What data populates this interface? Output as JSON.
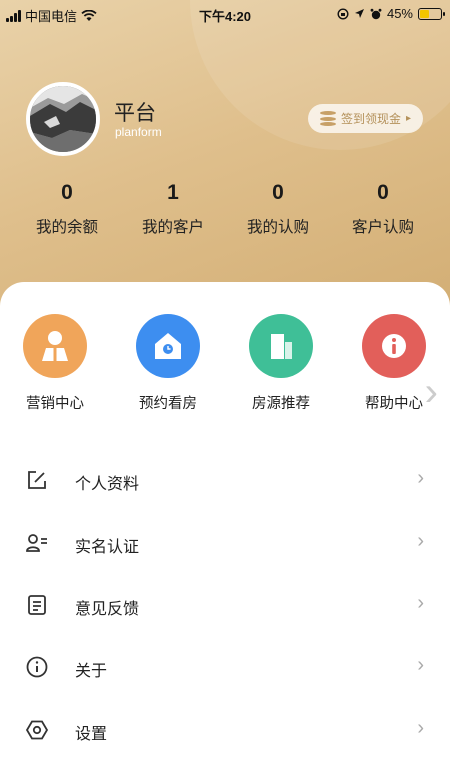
{
  "status_bar": {
    "carrier": "中国电信",
    "time": "下午4:20",
    "battery_percent": "45%",
    "battery_level": 0.45,
    "battery_fill_color": "#f2c500"
  },
  "profile": {
    "name": "平台",
    "subtitle": "planform",
    "checkin_label": "签到领现金"
  },
  "stats": [
    {
      "value": "0",
      "label": "我的余额"
    },
    {
      "value": "1",
      "label": "我的客户"
    },
    {
      "value": "0",
      "label": "我的认购"
    },
    {
      "value": "0",
      "label": "客户认购"
    }
  ],
  "quick_actions": [
    {
      "label": "营销中心",
      "icon": "person-icon",
      "color": "#f0a55a"
    },
    {
      "label": "预约看房",
      "icon": "house-icon",
      "color": "#3d8ef0"
    },
    {
      "label": "房源推荐",
      "icon": "building-icon",
      "color": "#3fbf97"
    },
    {
      "label": "帮助中心",
      "icon": "info-icon",
      "color": "#e25f5a"
    }
  ],
  "menu": [
    {
      "label": "个人资料",
      "icon": "edit-icon"
    },
    {
      "label": "实名认证",
      "icon": "user-id-icon"
    },
    {
      "label": "意见反馈",
      "icon": "document-icon"
    },
    {
      "label": "关于",
      "icon": "info-circle-icon"
    },
    {
      "label": "设置",
      "icon": "settings-icon"
    }
  ],
  "colors": {
    "header_gradient_start": "#e9d2a9",
    "header_gradient_end": "#d2ad73",
    "accent_text": "#b4915a"
  }
}
